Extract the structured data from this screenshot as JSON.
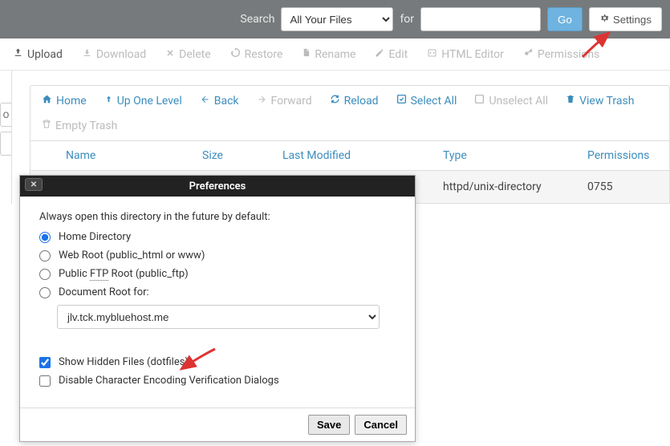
{
  "topbar": {
    "search_label": "Search",
    "scope_selected": "All Your Files",
    "for_label": "for",
    "search_value": "",
    "go_label": "Go",
    "settings_label": "Settings"
  },
  "actions": {
    "upload": "Upload",
    "download": "Download",
    "delete": "Delete",
    "restore": "Restore",
    "rename": "Rename",
    "edit": "Edit",
    "html_editor": "HTML Editor",
    "permissions": "Permissions"
  },
  "nav": {
    "home": "Home",
    "up": "Up One Level",
    "back": "Back",
    "forward": "Forward",
    "reload": "Reload",
    "select_all": "Select All",
    "unselect_all": "Unselect All",
    "view_trash": "View Trash",
    "empty_trash": "Empty Trash"
  },
  "table": {
    "headers": {
      "name": "Name",
      "size": "Size",
      "modified": "Last Modified",
      "type": "Type",
      "permissions": "Permissions"
    },
    "rows": [
      {
        "name": "",
        "size": "",
        "modified": "",
        "type": "httpd/unix-directory",
        "permissions": "0755"
      }
    ]
  },
  "modal": {
    "title": "Preferences",
    "prompt": "Always open this directory in the future by default:",
    "options": {
      "home": "Home Directory",
      "webroot": "Web Root (public_html or www)",
      "ftp": "Public FTP Root (public_ftp)",
      "docroot_label": "Document Root for:",
      "docroot_value": "jlv.tck.mybluehost.me"
    },
    "checks": {
      "show_hidden": "Show Hidden Files (dotfiles)",
      "disable_enc": "Disable Character Encoding Verification Dialogs"
    },
    "save": "Save",
    "cancel": "Cancel"
  },
  "left_tab": "o"
}
